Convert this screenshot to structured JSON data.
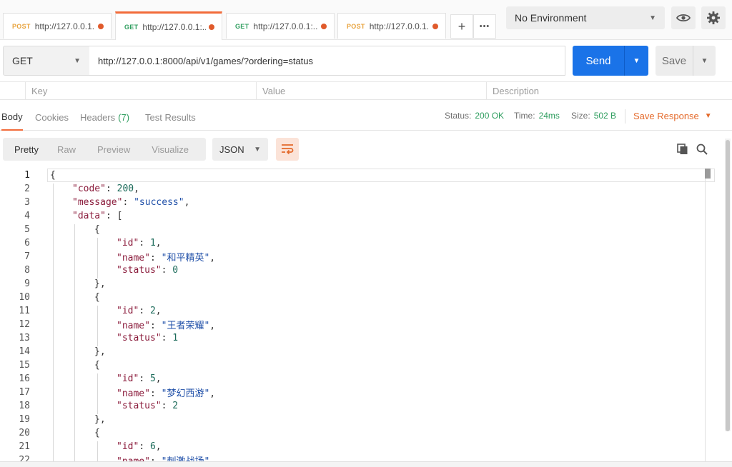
{
  "tabs": [
    {
      "method": "POST",
      "url": "http://127.0.0.1...",
      "active": false
    },
    {
      "method": "GET",
      "url": "http://127.0.0.1:...",
      "active": true
    },
    {
      "method": "GET",
      "url": "http://127.0.0.1:...",
      "active": false
    },
    {
      "method": "POST",
      "url": "http://127.0.0.1...",
      "active": false
    }
  ],
  "tab_actions": {
    "new_tab": "+",
    "more": "•••"
  },
  "environment": {
    "selected": "No Environment"
  },
  "request": {
    "method": "GET",
    "url": "http://127.0.0.1:8000/api/v1/games/?ordering=status",
    "send_label": "Send",
    "save_label": "Save"
  },
  "params_header": {
    "key": "Key",
    "value": "Value",
    "description": "Description"
  },
  "response_tabs": [
    {
      "label": "Body",
      "active": true
    },
    {
      "label": "Cookies"
    },
    {
      "label": "Headers",
      "count": "(7)"
    },
    {
      "label": "Test Results"
    }
  ],
  "status": {
    "status_label": "Status:",
    "status_value": "200 OK",
    "time_label": "Time:",
    "time_value": "24ms",
    "size_label": "Size:",
    "size_value": "502 B",
    "save_response": "Save Response"
  },
  "view_modes": [
    "Pretty",
    "Raw",
    "Preview",
    "Visualize"
  ],
  "active_view": "Pretty",
  "format": "JSON",
  "colors": {
    "accent": "#f26b3a",
    "send": "#1a73e8",
    "success": "#2f9e5f",
    "key": "#8b1c3c",
    "string": "#1f4fa8",
    "number": "#1c6b5a"
  },
  "icons": [
    "eye-icon",
    "gear-icon",
    "wrap-icon",
    "copy-icon",
    "search-icon"
  ],
  "code_lines": [
    {
      "n": "1",
      "indent": 0,
      "parts": [
        [
          "p",
          "{"
        ]
      ]
    },
    {
      "n": "2",
      "indent": 1,
      "parts": [
        [
          "k",
          "\"code\""
        ],
        [
          "p",
          ": "
        ],
        [
          "n",
          "200"
        ],
        [
          "p",
          ","
        ]
      ]
    },
    {
      "n": "3",
      "indent": 1,
      "parts": [
        [
          "k",
          "\"message\""
        ],
        [
          "p",
          ": "
        ],
        [
          "s",
          "\"success\""
        ],
        [
          "p",
          ","
        ]
      ]
    },
    {
      "n": "4",
      "indent": 1,
      "parts": [
        [
          "k",
          "\"data\""
        ],
        [
          "p",
          ": ["
        ]
      ]
    },
    {
      "n": "5",
      "indent": 2,
      "parts": [
        [
          "p",
          "{"
        ]
      ]
    },
    {
      "n": "6",
      "indent": 3,
      "parts": [
        [
          "k",
          "\"id\""
        ],
        [
          "p",
          ": "
        ],
        [
          "n",
          "1"
        ],
        [
          "p",
          ","
        ]
      ]
    },
    {
      "n": "7",
      "indent": 3,
      "parts": [
        [
          "k",
          "\"name\""
        ],
        [
          "p",
          ": "
        ],
        [
          "s",
          "\"和平精英\""
        ],
        [
          "p",
          ","
        ]
      ]
    },
    {
      "n": "8",
      "indent": 3,
      "parts": [
        [
          "k",
          "\"status\""
        ],
        [
          "p",
          ": "
        ],
        [
          "n",
          "0"
        ]
      ]
    },
    {
      "n": "9",
      "indent": 2,
      "parts": [
        [
          "p",
          "},"
        ]
      ]
    },
    {
      "n": "10",
      "indent": 2,
      "parts": [
        [
          "p",
          "{"
        ]
      ]
    },
    {
      "n": "11",
      "indent": 3,
      "parts": [
        [
          "k",
          "\"id\""
        ],
        [
          "p",
          ": "
        ],
        [
          "n",
          "2"
        ],
        [
          "p",
          ","
        ]
      ]
    },
    {
      "n": "12",
      "indent": 3,
      "parts": [
        [
          "k",
          "\"name\""
        ],
        [
          "p",
          ": "
        ],
        [
          "s",
          "\"王者荣耀\""
        ],
        [
          "p",
          ","
        ]
      ]
    },
    {
      "n": "13",
      "indent": 3,
      "parts": [
        [
          "k",
          "\"status\""
        ],
        [
          "p",
          ": "
        ],
        [
          "n",
          "1"
        ]
      ]
    },
    {
      "n": "14",
      "indent": 2,
      "parts": [
        [
          "p",
          "},"
        ]
      ]
    },
    {
      "n": "15",
      "indent": 2,
      "parts": [
        [
          "p",
          "{"
        ]
      ]
    },
    {
      "n": "16",
      "indent": 3,
      "parts": [
        [
          "k",
          "\"id\""
        ],
        [
          "p",
          ": "
        ],
        [
          "n",
          "5"
        ],
        [
          "p",
          ","
        ]
      ]
    },
    {
      "n": "17",
      "indent": 3,
      "parts": [
        [
          "k",
          "\"name\""
        ],
        [
          "p",
          ": "
        ],
        [
          "s",
          "\"梦幻西游\""
        ],
        [
          "p",
          ","
        ]
      ]
    },
    {
      "n": "18",
      "indent": 3,
      "parts": [
        [
          "k",
          "\"status\""
        ],
        [
          "p",
          ": "
        ],
        [
          "n",
          "2"
        ]
      ]
    },
    {
      "n": "19",
      "indent": 2,
      "parts": [
        [
          "p",
          "},"
        ]
      ]
    },
    {
      "n": "20",
      "indent": 2,
      "parts": [
        [
          "p",
          "{"
        ]
      ]
    },
    {
      "n": "21",
      "indent": 3,
      "parts": [
        [
          "k",
          "\"id\""
        ],
        [
          "p",
          ": "
        ],
        [
          "n",
          "6"
        ],
        [
          "p",
          ","
        ]
      ]
    },
    {
      "n": "22",
      "indent": 3,
      "parts": [
        [
          "k",
          "\"name\""
        ],
        [
          "p",
          ": "
        ],
        [
          "s",
          "\"刺激战场\""
        ],
        [
          "p",
          ","
        ]
      ]
    }
  ]
}
